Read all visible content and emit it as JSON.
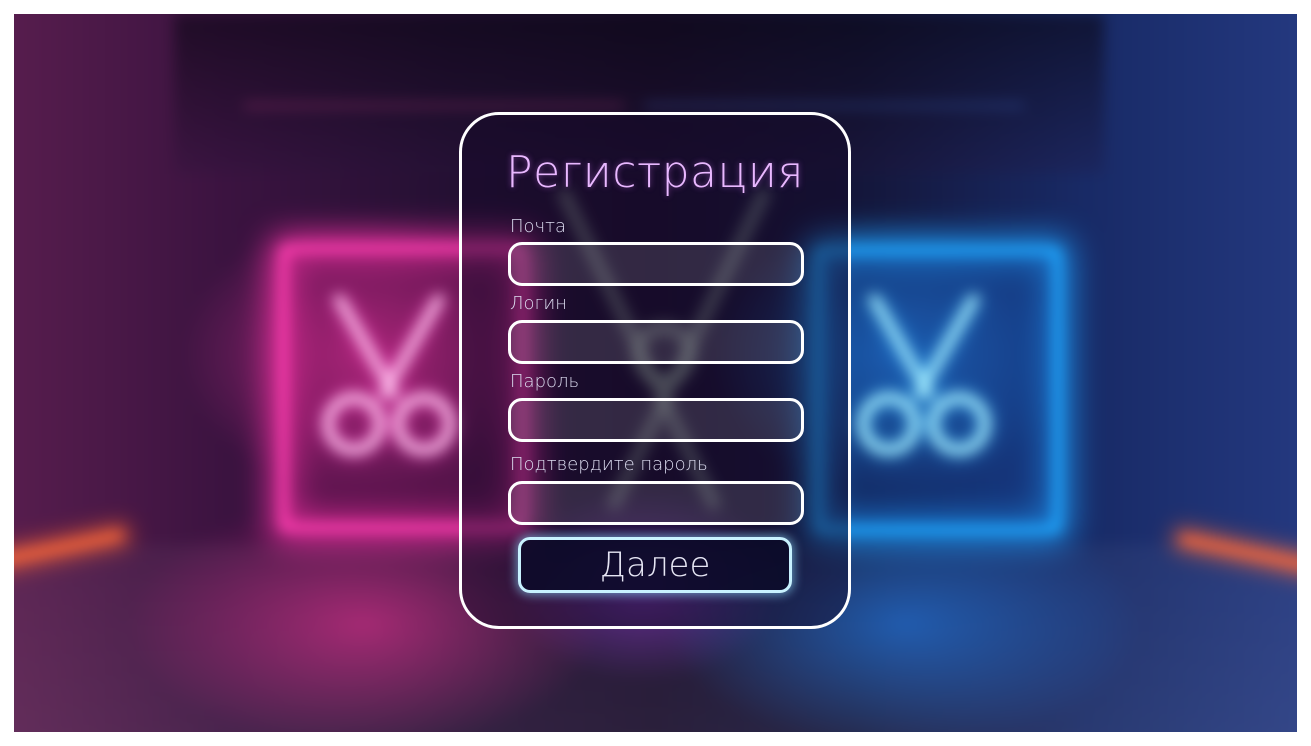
{
  "form": {
    "title": "Регистрация",
    "fields": [
      {
        "label": "Почта",
        "value": ""
      },
      {
        "label": "Логин",
        "value": ""
      },
      {
        "label": "Пароль",
        "value": ""
      },
      {
        "label": "Подтвердите пароль",
        "value": ""
      }
    ],
    "submit_label": "Далее"
  },
  "colors": {
    "title": "#e9b8ff",
    "neon_pink": "#ff3fb1",
    "neon_blue": "#1fa8ff",
    "button_border": "#c8f2ff"
  },
  "icons": {
    "background_left": "scissors-icon",
    "background_right": "scissors-icon",
    "background_center": "scissors-icon"
  }
}
